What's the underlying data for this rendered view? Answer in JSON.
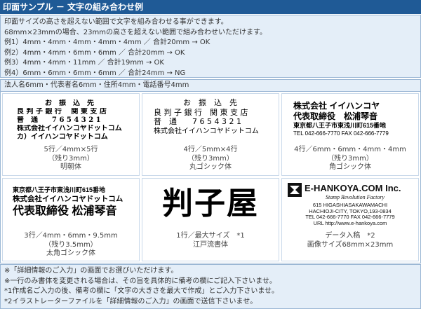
{
  "title": "印面サンプル － 文字の組み合わせ例",
  "intro_lines": [
    "印面サイズの高さを超えない範囲で文字を組み合わせる事ができます。",
    "68mm×23mmの場合、23mmの高さを超えない範囲で組み合わせいただけます。",
    "例1）4mm・4mm・4mm・4mm・4mm ／ 合計20mm → OK",
    "例2）4mm・4mm・6mm・6mm ／ 合計20mm → OK",
    "例3）4mm・4mm・11mm ／ 合計19mm → OK",
    "例4）6mm・6mm・6mm・6mm ／ 合計24mm → NG"
  ],
  "law_line": "法人名6mm・代表者名6mm・住所4mm・電話番号4mm",
  "samples": [
    {
      "stamp_lines": [
        "お　振　込　先",
        "良 判 子 銀 行　 関 東 支 店",
        "普　通　　7 6 5 4 3 2 1",
        "株式会社イイハンコヤドットコム",
        "カ）イイハンコヤドットコム"
      ],
      "caption_lines": [
        "5行／4mm×5行",
        "（残り3mm）",
        "明朝体"
      ]
    },
    {
      "stamp_lines": [
        "お　振　込　先",
        "良 判 子 銀 行　関 東 支 店",
        "普　通　　7 6 5 4 3 2 1",
        "株式会社イイハンコヤドットコム"
      ],
      "caption_lines": [
        "4行／5mm×4行",
        "（残り3mm）",
        "丸ゴシック体"
      ]
    },
    {
      "stamp_lines": [
        "株式会社 イイハンコヤ",
        "代表取締役　松浦琴音",
        "東京都八王子市東浅川町615番地",
        "TEL 042-666-7770 FAX 042-666-7779"
      ],
      "caption_lines": [
        "4行／6mm・6mm・4mm・4mm",
        "（残り3mm）",
        "角ゴシック体"
      ]
    },
    {
      "stamp_lines": [
        "東京都八王子市東浅川町615番地",
        "株式会社イイハンコヤドットコム",
        "代表取締役 松浦琴音"
      ],
      "caption_lines": [
        "3行／4mm・6mm・9.5mm",
        "（残り3.5mm）",
        "太角ゴシック体"
      ]
    },
    {
      "stamp_lines": [
        "判子屋"
      ],
      "caption_lines": [
        "1行／最大サイズ　*1",
        "江戸流書体"
      ]
    },
    {
      "stamp_lines": [
        "E-HANKOYA.COM Inc.",
        "Stamp Revolution Factory",
        "615 HIGASHIASAKAWAMACHI",
        "HACHIOJI-CITY, TOKYO,193-0834",
        "TEL 042-666-7770 FAX 042-666-7779",
        "URL http://www.e-hankoya.com"
      ],
      "caption_lines": [
        "データ入稿　*2",
        "画像サイズ68mm×23mm"
      ]
    }
  ],
  "notes": [
    "※「詳細情報のご入力」の画面でお選びいただけます。",
    "※一行のみ書体を変更される場合は、その旨を具体的に備考の欄にご記入下さいませ。",
    "*1作成名ご入力の後、備考の欄に「文字の大きさを最大で作成」とご入力下さいませ。",
    "*2イラストレーターファイルを「詳細情報のご入力」の画面で送信下さいませ。"
  ],
  "colors": {
    "title_bar": "#1f5a96",
    "panel_bg": "#e4eef8",
    "border": "#9ab6d4"
  }
}
